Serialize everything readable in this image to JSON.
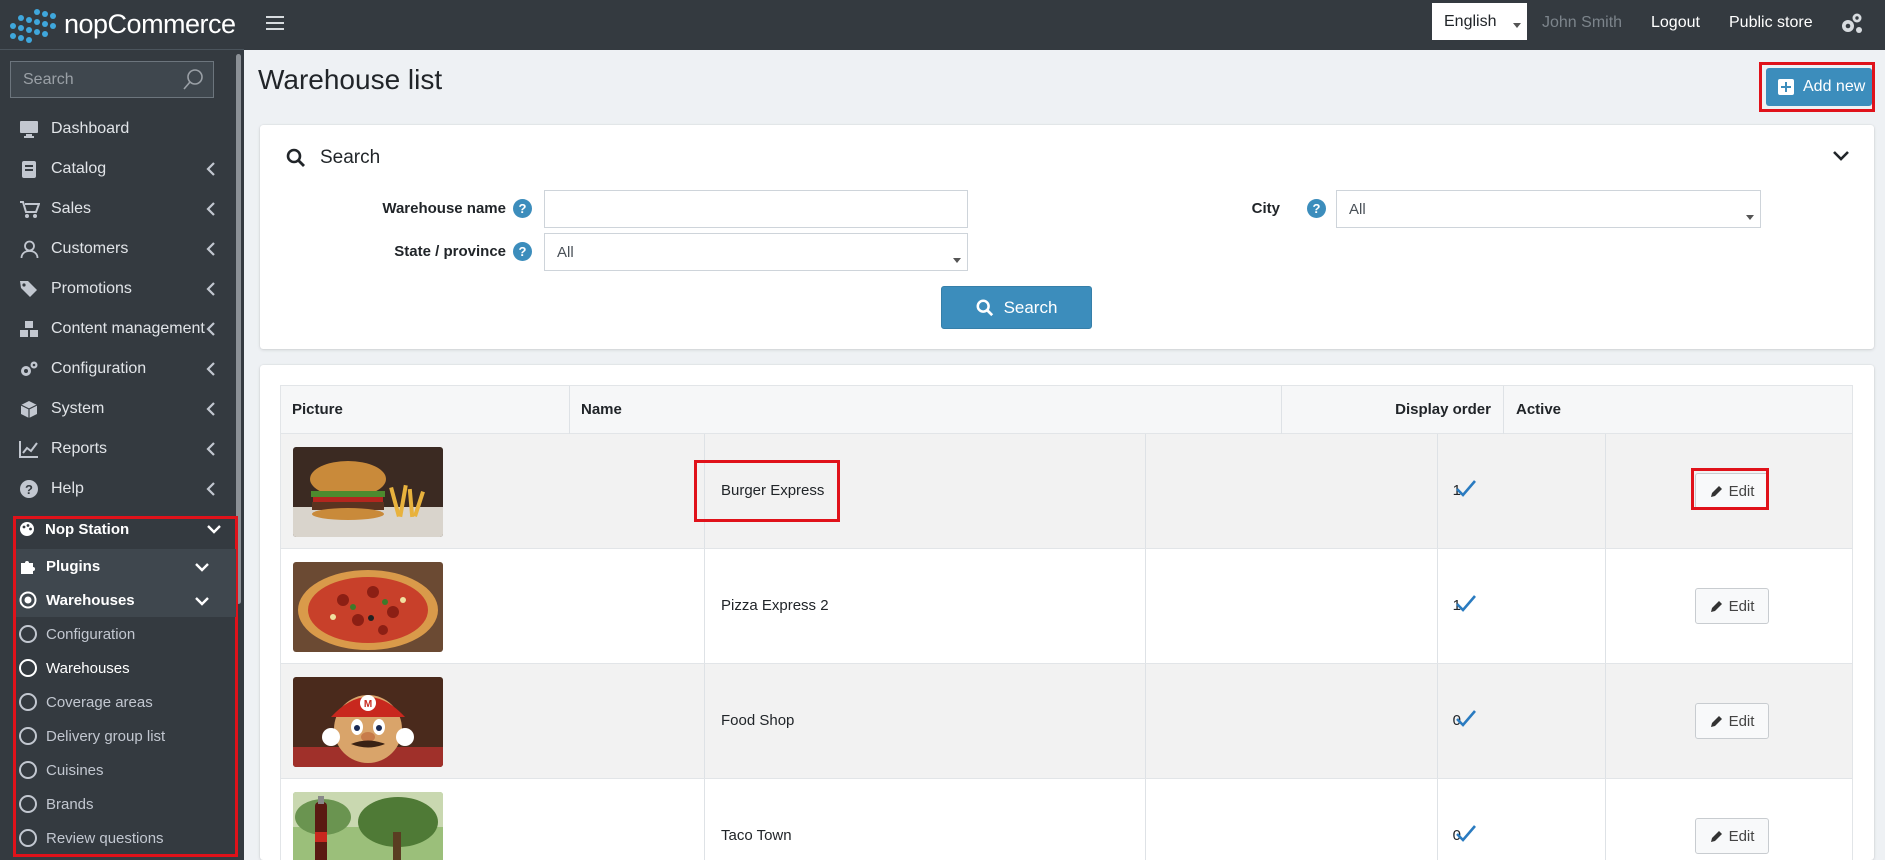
{
  "app": {
    "brand": "nopCommerce"
  },
  "sidebar": {
    "search_placeholder": "Search",
    "items": [
      {
        "label": "Dashboard"
      },
      {
        "label": "Catalog"
      },
      {
        "label": "Sales"
      },
      {
        "label": "Customers"
      },
      {
        "label": "Promotions"
      },
      {
        "label": "Content management"
      },
      {
        "label": "Configuration"
      },
      {
        "label": "System"
      },
      {
        "label": "Reports"
      },
      {
        "label": "Help"
      }
    ],
    "nop_station": {
      "label": "Nop Station",
      "plugins": "Plugins",
      "warehouses_group": "Warehouses",
      "sub_items": [
        {
          "label": "Configuration"
        },
        {
          "label": "Warehouses"
        },
        {
          "label": "Coverage areas"
        },
        {
          "label": "Delivery group list"
        },
        {
          "label": "Cuisines"
        },
        {
          "label": "Brands"
        },
        {
          "label": "Review questions"
        }
      ]
    }
  },
  "topbar": {
    "language": "English",
    "user": "John Smith",
    "logout": "Logout",
    "public_store": "Public store"
  },
  "page": {
    "title": "Warehouse list",
    "add_new": "Add new"
  },
  "search": {
    "heading": "Search",
    "warehouse_name_label": "Warehouse name",
    "warehouse_name_value": "",
    "state_label": "State / province",
    "state_value": "All",
    "city_label": "City",
    "city_value": "All",
    "button": "Search"
  },
  "table": {
    "columns": [
      "Picture",
      "Name",
      "Display order",
      "Active"
    ],
    "edit_label": "Edit",
    "rows": [
      {
        "name": "Burger Express",
        "display_order": "1",
        "active": true,
        "picture": "burger"
      },
      {
        "name": "Pizza Express 2",
        "display_order": "1",
        "active": true,
        "picture": "pizza"
      },
      {
        "name": "Food Shop",
        "display_order": "0",
        "active": true,
        "picture": "character"
      },
      {
        "name": "Taco Town",
        "display_order": "0",
        "active": true,
        "picture": "cola"
      }
    ]
  },
  "colors": {
    "accent": "#3c8dbc",
    "sidebar": "#343a40",
    "highlight": "#e0121a",
    "check": "#2a7bc0"
  }
}
